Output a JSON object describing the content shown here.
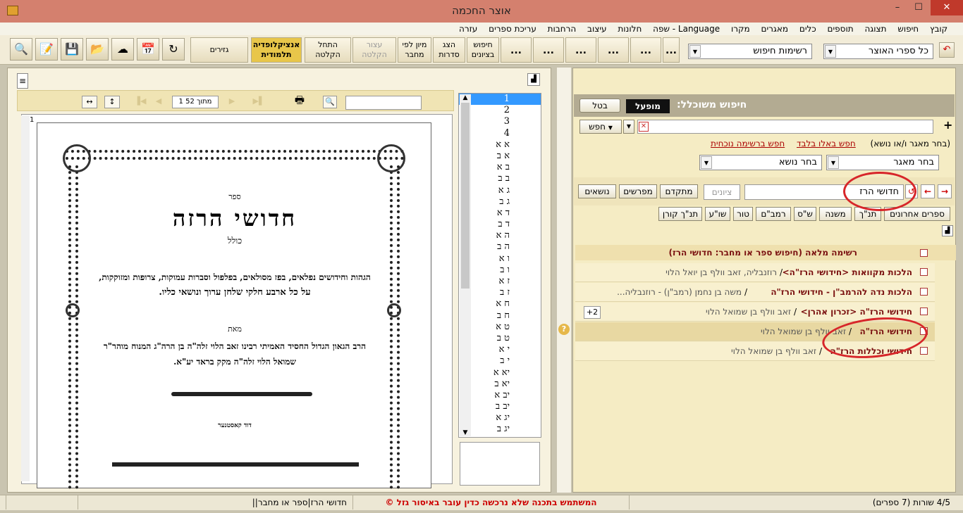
{
  "window": {
    "title": "אוצר החכמה",
    "min": "–",
    "max": "☐",
    "close": "✕"
  },
  "menu": [
    "קובץ",
    "חיפוש",
    "תצוגה",
    "תוספים",
    "כלים",
    "מאגרים",
    "מקרו",
    "Language - שפה",
    "חלונות",
    "עיצוב",
    "הרחבות",
    "עריכת ספרים",
    "עזרה"
  ],
  "toolbar": {
    "icons": [
      "magnifier-icon",
      "notes-icon",
      "save-icon",
      "folder-icon",
      "cloud-icon",
      "calendar-icon",
      "refresh-icon"
    ],
    "gzirim": "גזירים",
    "encyclopedia": "אנציקלופדיה תלמודית",
    "start_recording": "התחל הקלטה",
    "stop_recording": "עצור הקלטה",
    "sort_by": "מיון לפי מחבר",
    "show_series": "הצג סדרות",
    "search_citations": "חיפוש בציונים",
    "dots": "..."
  },
  "combos": {
    "search_lists": "רשימות חיפוש",
    "all_books": "כל ספרי האוצר"
  },
  "viewer": {
    "page_indicator": "1 מתוך 52",
    "page_num": "1"
  },
  "doc": {
    "sefer": "ספר",
    "title": "חדושי הרזה",
    "kolel": "כולל",
    "line1": "הגהות וחידושים נפלאים, בפז מסולאים, בפלפול וסברות עמוקות, צרופות ומזוקקות,",
    "line2": "על כל ארבע חלקי שלחן ערוך ונושאי כליו.",
    "meet": "מאת",
    "line3": "הרב הגאון הגדול החסיד האמיתי רבינו זאב הלוי זלה\"ה בן הרה\"ג המנוח מוהר\"ר",
    "line4": "שמואל הלוי זלה\"ה מקק בראד יע\"א.",
    "footer": "דוד קאסטנער"
  },
  "pages": [
    "1",
    "2",
    "3",
    "4",
    "א א",
    "א ב",
    "ב א",
    "ב ב",
    "ג א",
    "ג ב",
    "ד א",
    "ד ב",
    "ה א",
    "ה ב",
    "ו א",
    "ו ב",
    "ז א",
    "ז ב",
    "ח א",
    "ח ב",
    "ט א",
    "ט ב",
    "י א",
    "י ב",
    "יא א",
    "יא ב",
    "יב א",
    "יב ב",
    "יג א",
    "יג ב"
  ],
  "search": {
    "label": "חיפוש משוכלל:",
    "active": "מופעל",
    "cancel": "בטל",
    "search_btn": "חפש",
    "hint": "(בחר מאגר ו/או נושא)",
    "search_only_these": "חפש באלו בלבד",
    "search_current_list": "חפש ברשימה נוכחית",
    "choose_repo": "בחר מאגר",
    "choose_topic": "בחר נושא",
    "query": "חדושי הרז",
    "citations_ph": "ציונים",
    "advanced": "מתקדם",
    "commentators": "מפרשים",
    "topics": "נושאים"
  },
  "categories": [
    "ספרים אחרונים",
    "תנ\"ך",
    "משנה",
    "ש\"ס",
    "רמב\"ם",
    "טור",
    "שו\"ע",
    "תנ\"ך קורן"
  ],
  "results": {
    "header": "רשימה מלאה (חיפוש  ספר או מחבר: חדושי הרז)",
    "rows": [
      {
        "title": "הלכות מקוואות <חידושי הרז\"ה>",
        "author": "רוזנבליה, זאב וולף בן יואל הלוי"
      },
      {
        "title": "הלכות נדה להרמב\"ן - חידושי הרז\"ה",
        "author": "משה בן נחמן (רמב\"ן) - רוזנבליה..."
      },
      {
        "title": "חידושי הרז\"ה <זכרון אהרן>",
        "author": "זאב וולף בן שמואל הלוי",
        "badge": "+2"
      },
      {
        "title": "חידושי הרז\"ה",
        "author": "זאב וולף בן שמואל הלוי"
      },
      {
        "title": "חידושי וכללות הרז\"ה",
        "author": "זאב וולף בן שמואל הלוי"
      }
    ]
  },
  "status": {
    "rows": "4/5 שורות (7 ספרים)",
    "warning": "המשתמש בתכנה שלא נרכשה כדין עובר באיסור גזל  ©",
    "path": "||חדושי הרז|ספר או מחבר"
  },
  "colors": {
    "accent": "#d7262a",
    "title_bar": "#d4806e",
    "panel": "#f5ecc4"
  }
}
